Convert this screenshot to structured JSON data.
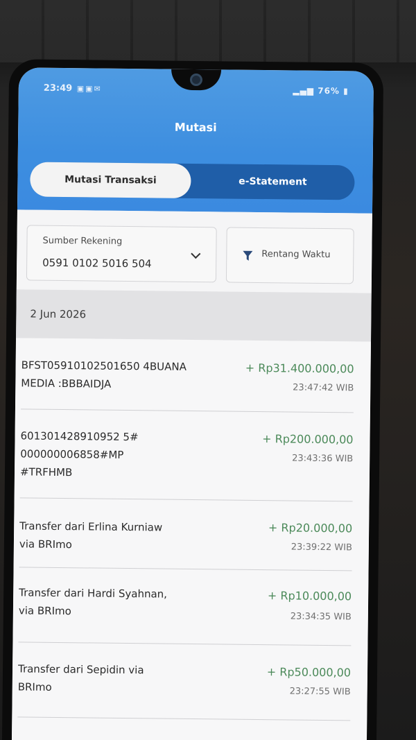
{
  "status": {
    "time": "23:49",
    "battery": "76%"
  },
  "header": {
    "title": "Mutasi"
  },
  "tabs": [
    {
      "label": "Mutasi Transaksi",
      "active": true
    },
    {
      "label": "e-Statement",
      "active": false
    }
  ],
  "filters": {
    "source_label": "Sumber Rekening",
    "source_value": "0591 0102 5016 504",
    "range_label": "Rentang Waktu"
  },
  "date": "2 Jun 2026",
  "transactions": [
    {
      "description": "BFST05910102501650 4BUANA\nMEDIA :BBBAIDJA",
      "amount": "+ Rp31.400.000,00",
      "time": "23:47:42 WIB"
    },
    {
      "description": "601301428910952 5#\n000000006858#MP\n#TRFHMB",
      "amount": "+ Rp200.000,00",
      "time": "23:43:36 WIB"
    },
    {
      "description": "Transfer dari Erlina Kurniaw\nvia BRImo",
      "amount": "+ Rp20.000,00",
      "time": "23:39:22 WIB"
    },
    {
      "description": "Transfer dari Hardi Syahnan,\nvia BRImo",
      "amount": "+ Rp10.000,00",
      "time": "23:34:35 WIB"
    },
    {
      "description": "Transfer dari Sepidin via\nBRImo",
      "amount": "+ Rp50.000,00",
      "time": "23:27:55 WIB"
    }
  ],
  "colors": {
    "header_blue": "#3d8ee0",
    "tab_dark": "#1f5ea8",
    "amount_green": "#4c8a5a"
  }
}
